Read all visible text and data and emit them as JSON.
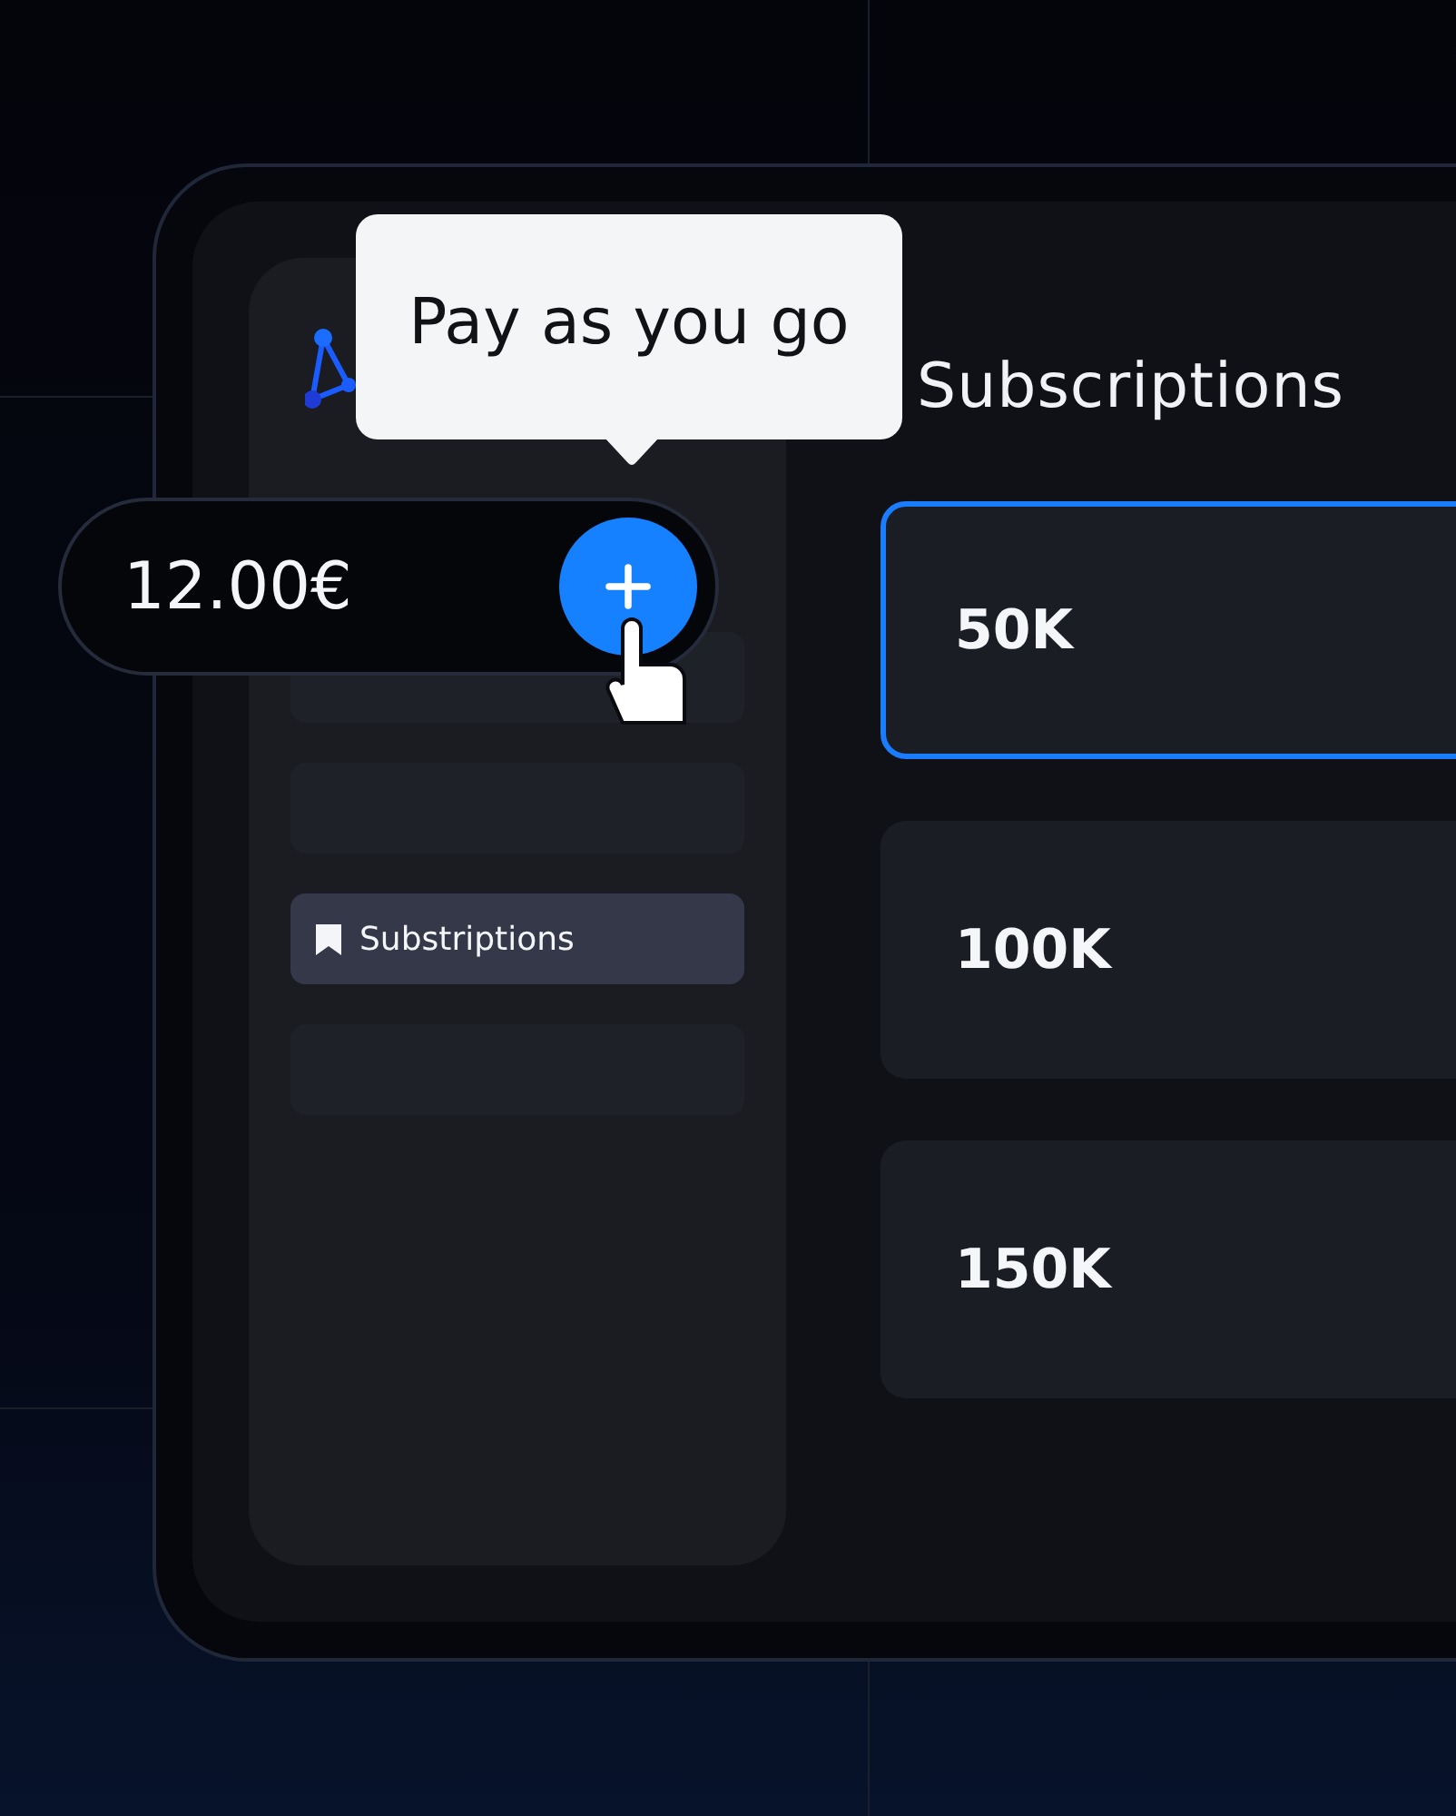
{
  "tooltip": {
    "text": "Pay as you go"
  },
  "amount": {
    "value": "12.00€"
  },
  "heading": "Subscriptions",
  "sidebar_items": [
    {
      "kind": "blank",
      "selected": false
    },
    {
      "kind": "blank",
      "selected": false
    },
    {
      "kind": "link",
      "label": "Substriptions",
      "selected": true
    },
    {
      "kind": "blank",
      "selected": false
    }
  ],
  "plans": [
    {
      "label": "50K",
      "selected": true
    },
    {
      "label": "100K",
      "selected": false
    },
    {
      "label": "150K",
      "selected": false
    }
  ]
}
